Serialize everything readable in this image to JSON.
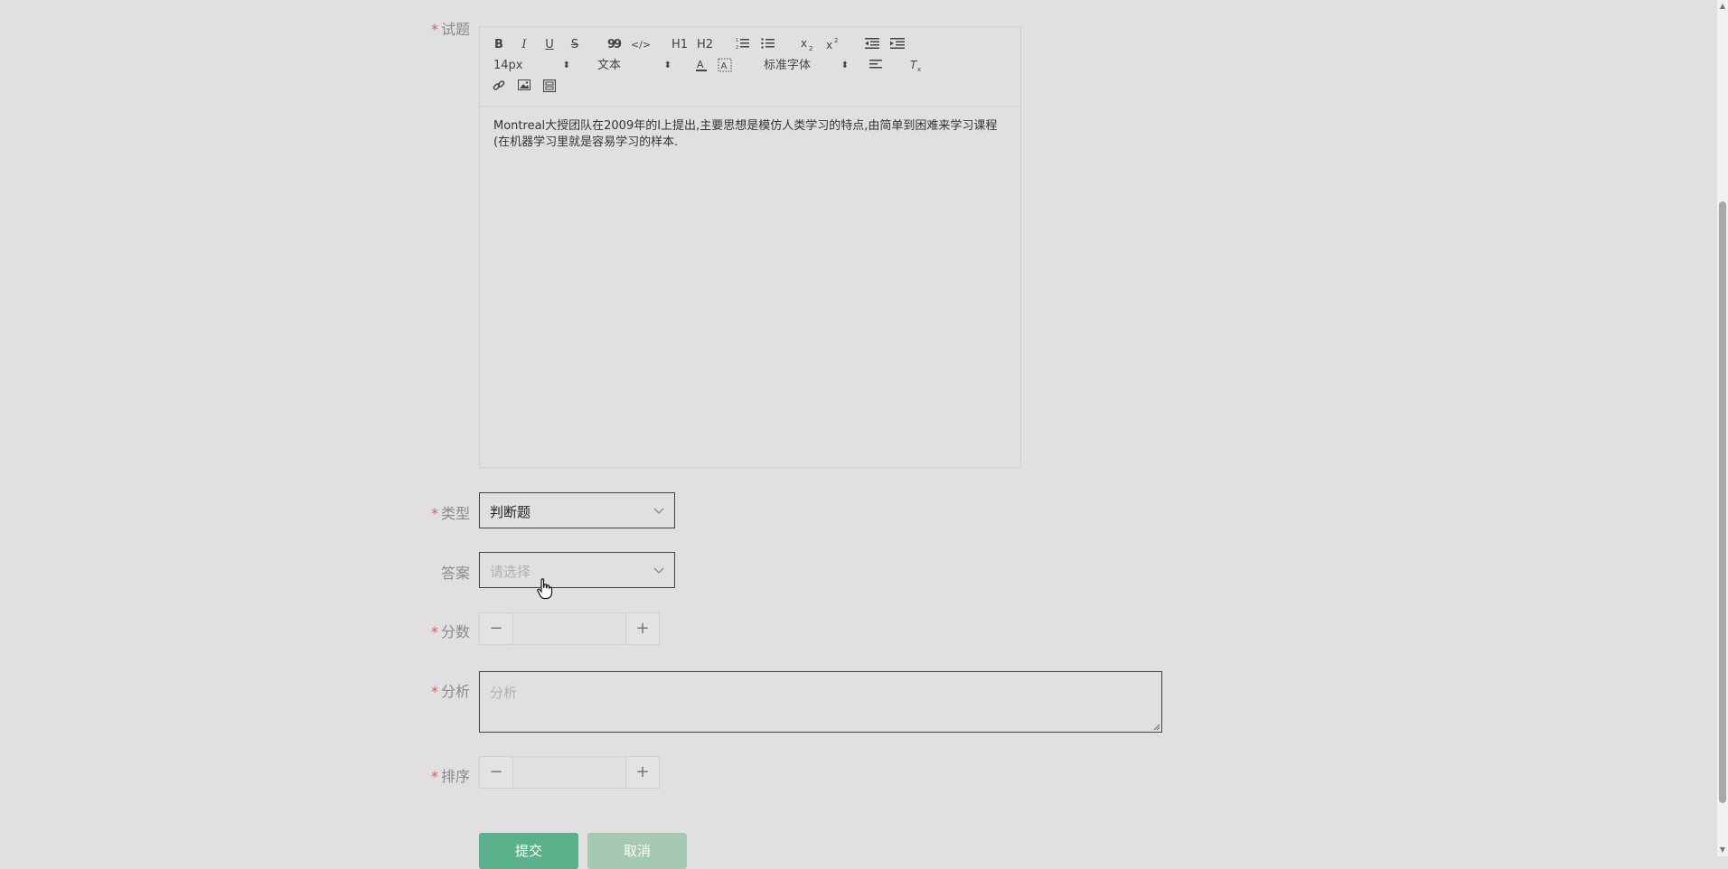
{
  "form": {
    "question_label": "试题",
    "type_label": "类型",
    "answer_label": "答案",
    "score_label": "分数",
    "analysis_label": "分析",
    "order_label": "排序",
    "required_mark": "*"
  },
  "editor": {
    "toolbar": {
      "bold": "B",
      "italic": "I",
      "underline": "U",
      "strike": "S",
      "quote": "99",
      "code": "</>",
      "h1": "H1",
      "h2": "H2",
      "font_size": "14px",
      "text_style": "文本",
      "font_family": "标准字体"
    },
    "content": "Montreal大授团队在2009年的I上提出,主要思想是模仿人类学习的特点,由简单到困难来学习课程(在机器学习里就是容易学习的样本."
  },
  "type_select": {
    "value": "判断题"
  },
  "answer_select": {
    "placeholder": "请选择"
  },
  "score_stepper": {
    "minus": "−",
    "plus": "+",
    "value": ""
  },
  "analysis": {
    "placeholder": "分析"
  },
  "order_stepper": {
    "minus": "−",
    "plus": "+",
    "value": ""
  },
  "buttons": {
    "submit": "提交",
    "cancel": "取消"
  },
  "colors": {
    "primary": "#5cb18d",
    "secondary": "#a6c9b2",
    "required": "#e05a5a",
    "background": "#e0e0e0"
  }
}
